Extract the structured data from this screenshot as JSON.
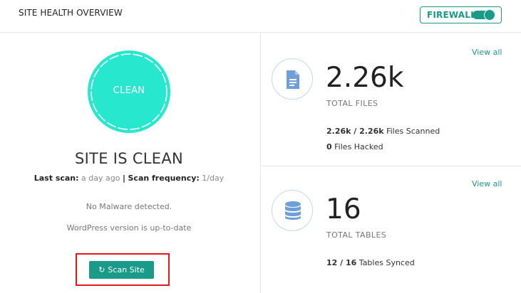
{
  "header": {
    "title": "SITE HEALTH OVERVIEW",
    "firewall_label": "FIREWALL",
    "firewall_on": true,
    "accent": "#1a9a88"
  },
  "health": {
    "badge_text": "CLEAN",
    "badge_color": "#27e8cf",
    "status_text": "SITE IS CLEAN",
    "last_scan_label": "Last scan:",
    "last_scan_value": "a day ago",
    "separator": "|",
    "frequency_label": "Scan frequency:",
    "frequency_value": "1/day",
    "message_malware": "No Malware detected.",
    "message_wp": "WordPress version is up-to-date",
    "scan_button": "Scan Site",
    "scan_button_icon": "refresh-icon"
  },
  "files_panel": {
    "view_all": "View all",
    "icon": "document-icon",
    "value": "2.26k",
    "label": "TOTAL FILES",
    "scanned_value": "2.26k / 2.26k",
    "scanned_text": "Files Scanned",
    "hacked_value": "0",
    "hacked_text": "Files Hacked"
  },
  "tables_panel": {
    "view_all": "View all",
    "icon": "database-icon",
    "value": "16",
    "label": "TOTAL TABLES",
    "synced_value": "12 / 16",
    "synced_text": "Tables Synced"
  }
}
